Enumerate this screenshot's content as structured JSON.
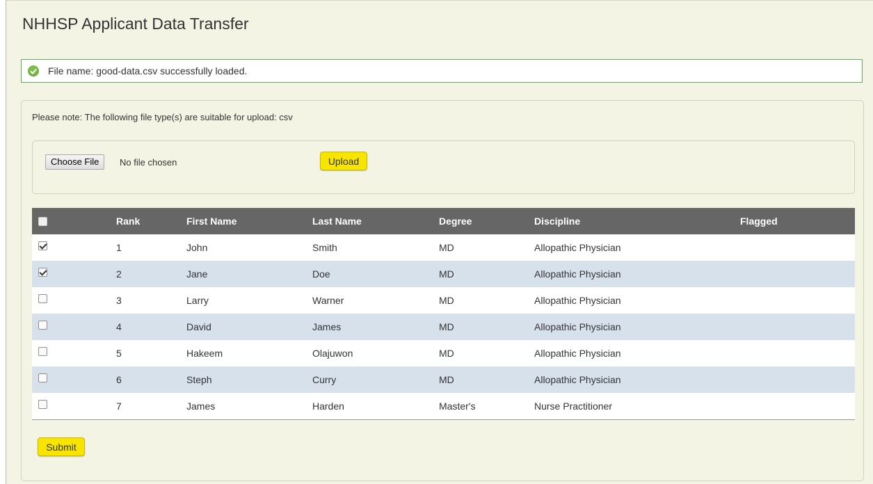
{
  "page": {
    "title": "NHHSP Applicant Data Transfer"
  },
  "alert": {
    "message": "File name: good-data.csv successfully loaded."
  },
  "upload": {
    "note": "Please note: The following file type(s) are suitable for upload: csv",
    "choose_file_label": "Choose File",
    "no_file_text": "No file chosen",
    "upload_label": "Upload"
  },
  "table": {
    "headers": [
      "",
      "Rank",
      "First Name",
      "Last Name",
      "Degree",
      "Discipline",
      "Flagged"
    ],
    "rows": [
      {
        "checked": true,
        "rank": "1",
        "first": "John",
        "last": "Smith",
        "degree": "MD",
        "discipline": "Allopathic Physician",
        "flagged": ""
      },
      {
        "checked": true,
        "rank": "2",
        "first": "Jane",
        "last": "Doe",
        "degree": "MD",
        "discipline": "Allopathic Physician",
        "flagged": ""
      },
      {
        "checked": false,
        "rank": "3",
        "first": "Larry",
        "last": "Warner",
        "degree": "MD",
        "discipline": "Allopathic Physician",
        "flagged": ""
      },
      {
        "checked": false,
        "rank": "4",
        "first": "David",
        "last": "James",
        "degree": "MD",
        "discipline": "Allopathic Physician",
        "flagged": ""
      },
      {
        "checked": false,
        "rank": "5",
        "first": "Hakeem",
        "last": "Olajuwon",
        "degree": "MD",
        "discipline": "Allopathic Physician",
        "flagged": ""
      },
      {
        "checked": false,
        "rank": "6",
        "first": "Steph",
        "last": "Curry",
        "degree": "MD",
        "discipline": "Allopathic Physician",
        "flagged": ""
      },
      {
        "checked": false,
        "rank": "7",
        "first": "James",
        "last": "Harden",
        "degree": "Master's",
        "discipline": "Nurse Practitioner",
        "flagged": ""
      }
    ]
  },
  "submit": {
    "label": "Submit"
  },
  "colors": {
    "accent_yellow": "#f7e500",
    "header_gray": "#666666",
    "row_alt": "#d7e1ec",
    "success_green": "#7dbd4a"
  }
}
